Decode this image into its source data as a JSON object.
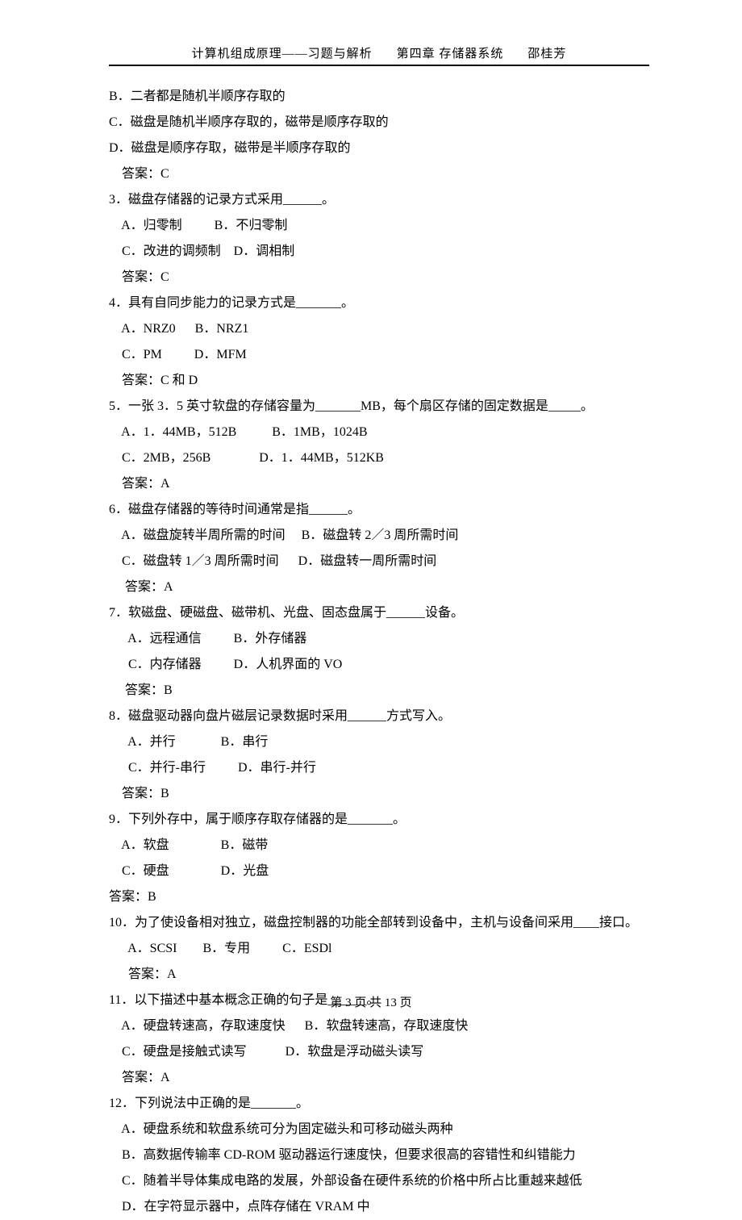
{
  "header": {
    "title": "计算机组成原理——习题与解析",
    "chapter": "第四章  存储器系统",
    "author": "邵桂芳"
  },
  "lines": [
    "B．二者都是随机半顺序存取的",
    "C．磁盘是随机半顺序存取的，磁带是顺序存取的",
    "D．磁盘是顺序存取，磁带是半顺序存取的",
    "    答案：C",
    "3．磁盘存储器的记录方式采用______。",
    "    A．归零制          B．不归零制",
    "    C．改进的调频制    D．调相制",
    "    答案：C",
    "4．具有自同步能力的记录方式是_______。",
    "    A．NRZ0      B．NRZ1",
    "    C．PM          D．MFM",
    "    答案：C 和 D",
    "5．一张 3．5 英寸软盘的存储容量为_______MB，每个扇区存储的固定数据是_____。",
    "    A．1．44MB，512B           B．1MB，1024B",
    "    C．2MB，256B               D．1．44MB，512KB",
    "    答案：A",
    "6．磁盘存储器的等待时间通常是指______。",
    "    A．磁盘旋转半周所需的时间     B．磁盘转 2／3 周所需时间",
    "    C．磁盘转 1／3 周所需时间      D．磁盘转一周所需时间",
    "     答案：A",
    "7．软磁盘、硬磁盘、磁带机、光盘、固态盘属于______设备。",
    "      A．远程通信          B．外存储器",
    "      C．内存储器          D．人机界面的 VO",
    "     答案：B",
    "8．磁盘驱动器向盘片磁层记录数据时采用______方式写入。",
    "      A．并行              B．串行",
    "      C．并行-串行          D．串行-并行",
    "    答案：B",
    "9．下列外存中，属于顺序存取存储器的是_______。",
    "    A．软盘                B．磁带",
    "    C．硬盘                D．光盘",
    "答案：B",
    "10．为了使设备相对独立，磁盘控制器的功能全部转到设备中，主机与设备间采用____接口。",
    "      A．SCSI        B．专用          C．ESDl",
    "      答案：A",
    "11．以下描述中基本概念正确的句子是______。",
    "    A．硬盘转速高，存取速度快      B．软盘转速高，存取速度快",
    "    C．硬盘是接触式读写            D．软盘是浮动磁头读写",
    "    答案：A",
    "12．下列说法中正确的是_______。",
    "    A．硬盘系统和软盘系统可分为固定磁头和可移动磁头两种",
    "    B．高数据传输率 CD-ROM 驱动器运行速度快，但要求很高的容错性和纠错能力",
    "    C．随着半导体集成电路的发展，外部设备在硬件系统的价格中所占比重越来越低",
    "    D．在字符显示器中，点阵存储在 VRAM 中"
  ],
  "footer": "第 3 页 共 13 页"
}
